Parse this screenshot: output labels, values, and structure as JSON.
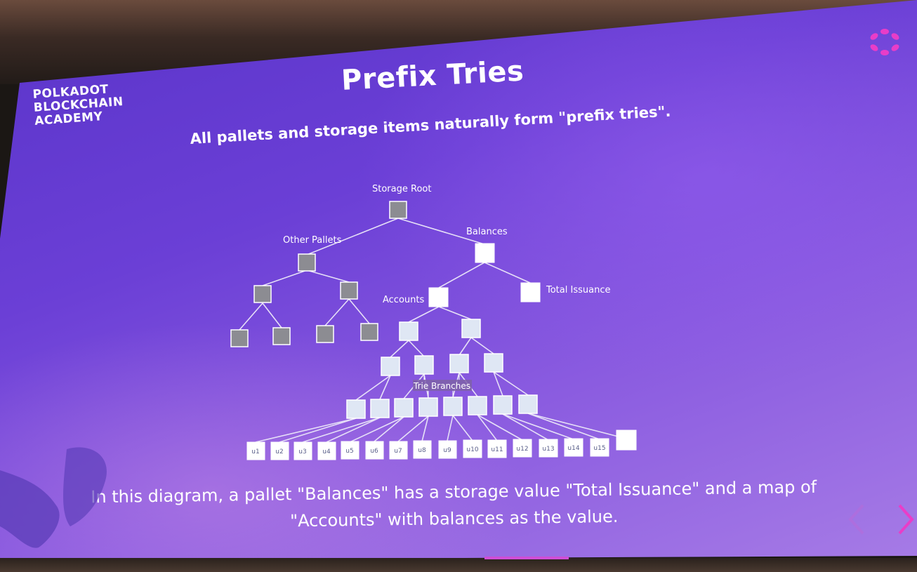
{
  "slide": {
    "brand_lines": [
      "POLKADOT",
      "BLOCKCHAIN",
      "ACADEMY"
    ],
    "title": "Prefix Tries",
    "subtitle": "All pallets and storage items naturally form \"prefix tries\".",
    "caption_lines": [
      "In this diagram, a pallet \"Balances\" has a storage value \"Total Issuance\" and a map of",
      "\"Accounts\" with balances as the value."
    ],
    "logo_icon": "polkadot-ring-icon",
    "colors": {
      "background": "#6b3fd6",
      "logo": "#e93dc8",
      "gray_node": "#8c8c92",
      "light_node": "#dfe7f4",
      "white_node": "#ffffff"
    }
  },
  "diagram": {
    "labels": {
      "root": "Storage Root",
      "other_pallets": "Other Pallets",
      "balances": "Balances",
      "accounts": "Accounts",
      "total_issuance": "Total Issuance",
      "trie_branches": "Trie Branches"
    },
    "leaves": [
      "u1",
      "u2",
      "u3",
      "u4",
      "u5",
      "u6",
      "u7",
      "u8",
      "u9",
      "u10",
      "u11",
      "u12",
      "u13",
      "u14",
      "u15"
    ]
  },
  "navigation": {
    "prev_icon": "chevron-left-icon",
    "next_icon": "chevron-right-icon"
  }
}
